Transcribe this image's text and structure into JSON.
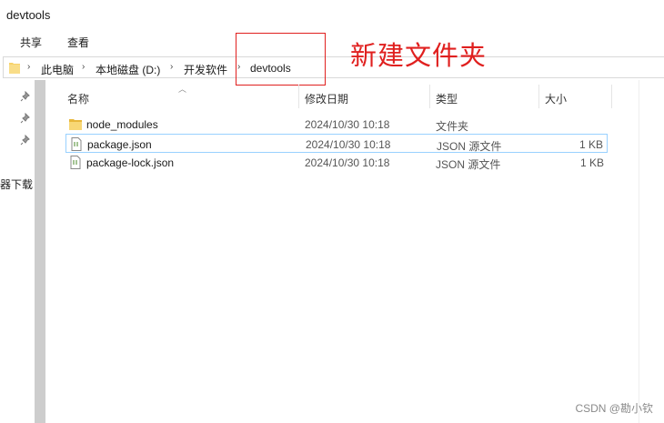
{
  "window": {
    "title": "devtools"
  },
  "ribbon": {
    "tabs": [
      "共享",
      "查看"
    ]
  },
  "address": {
    "crumbs": [
      "此电脑",
      "本地磁盘 (D:)",
      "开发软件",
      "devtools"
    ],
    "separator": "›"
  },
  "annotation": {
    "text": "新建文件夹",
    "color": "#e0201f"
  },
  "nav": {
    "partial_item": "器下载"
  },
  "columns": {
    "name": "名称",
    "modified": "修改日期",
    "type": "类型",
    "size": "大小"
  },
  "files": [
    {
      "name": "node_modules",
      "modified": "2024/10/30 10:18",
      "type": "文件夹",
      "size": "",
      "icon": "folder-icon"
    },
    {
      "name": "package.json",
      "modified": "2024/10/30 10:18",
      "type": "JSON 源文件",
      "size": "1 KB",
      "icon": "json-file-icon"
    },
    {
      "name": "package-lock.json",
      "modified": "2024/10/30 10:18",
      "type": "JSON 源文件",
      "size": "1 KB",
      "icon": "json-file-icon"
    }
  ],
  "watermark": "CSDN @勘小钦"
}
